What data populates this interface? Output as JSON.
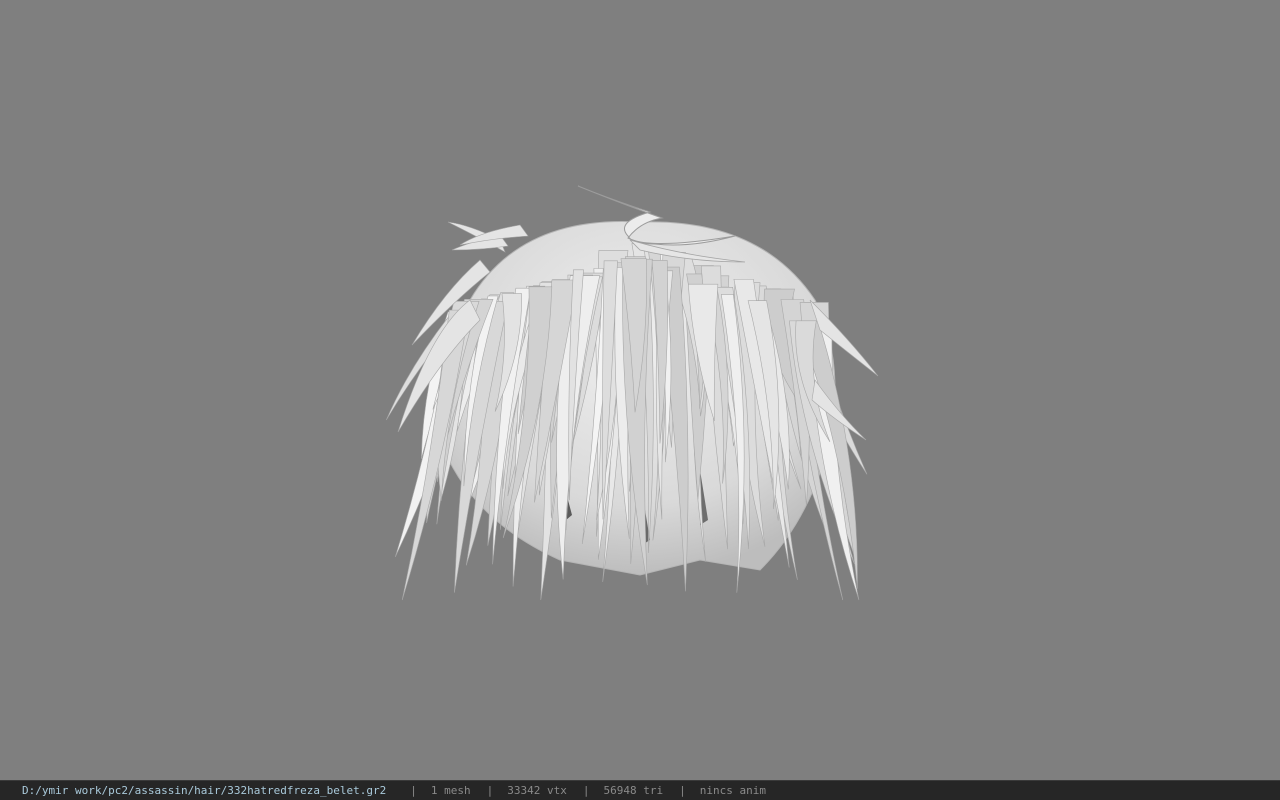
{
  "viewport": {
    "background": "#7f7f7f",
    "model": {
      "name": "hair-mesh",
      "color": "#e2e2e2"
    }
  },
  "status_bar": {
    "file_path": "D:/ymir work/pc2/assassin/hair/332hatredfreza_belet.gr2",
    "separator": "|",
    "mesh_count": "1 mesh",
    "vertex_count": "33342 vtx",
    "triangle_count": "56948 tri",
    "animation": "nincs anim"
  }
}
